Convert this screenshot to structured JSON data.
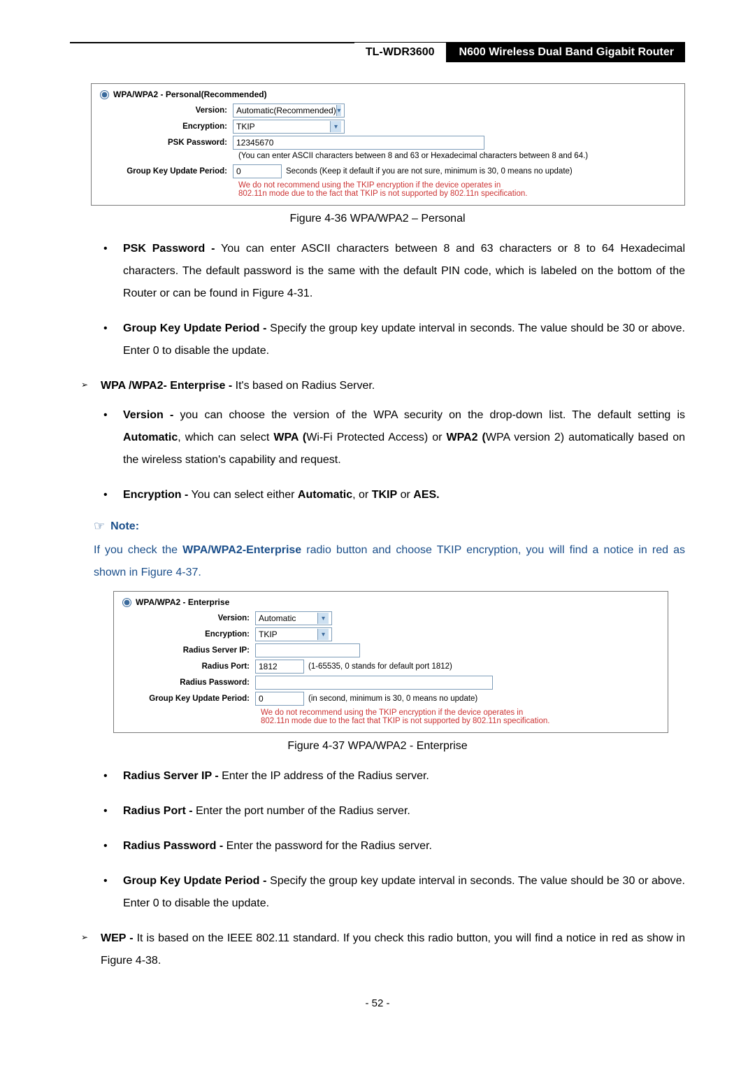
{
  "header": {
    "model": "TL-WDR3600",
    "title": "N600 Wireless Dual Band Gigabit Router"
  },
  "fig36": {
    "radio_label": "WPA/WPA2 - Personal(Recommended)",
    "labels": {
      "version": "Version:",
      "encryption": "Encryption:",
      "psk": "PSK Password:",
      "gkup": "Group Key Update Period:"
    },
    "values": {
      "version_sel": "Automatic(Recommended)",
      "encryption_sel": "TKIP",
      "psk_val": "12345670",
      "gkup_val": "0"
    },
    "hints": {
      "psk_hint": "(You can enter ASCII characters between 8 and 63 or Hexadecimal characters between 8 and 64.)",
      "gkup_hint": "Seconds (Keep it default if you are not sure, minimum is 30, 0 means no update)",
      "warn_l1": "We do not recommend using the TKIP encryption if the device operates in",
      "warn_l2": "802.11n mode due to the fact that TKIP is not supported by 802.11n specification."
    },
    "caption": "Figure 4-36 WPA/WPA2 – Personal"
  },
  "bullets_a": {
    "psk": {
      "head": "PSK Password -",
      "body": " You can enter ASCII characters between 8 and 63 characters or 8 to 64 Hexadecimal characters. The default password is the same with the default PIN code, which is labeled on the bottom of the Router or can be found in Figure 4-31."
    },
    "gkup": {
      "head": "Group Key Update Period -",
      "body": " Specify the group key update interval in seconds. The value should be 30 or above. Enter 0 to disable the update."
    }
  },
  "wpa_ent_head": {
    "title": "WPA /WPA2- Enterprise -",
    "body": " It's based on Radius Server."
  },
  "bullets_b": {
    "ver": {
      "head": "Version  -",
      "b": " you can choose the version of the WPA security on the drop-down list. The default setting is ",
      "auto": "Automatic",
      "c": ", which can select  ",
      "wpa": "WPA (",
      "d": "Wi-Fi Protected Access) or ",
      "wpa2": "WPA2 (",
      "e": "WPA version 2) automatically based on the wireless station's capability and request."
    },
    "enc": {
      "head": "Encryption -",
      "b": "  You can select either ",
      "auto": "Automatic",
      "c": ", or ",
      "tkip": "TKIP",
      "d": " or ",
      "aes": "AES."
    }
  },
  "note": {
    "label": "Note:",
    "text_a": "If you check the ",
    "text_b": "WPA/WPA2-Enterprise",
    "text_c": " radio button and choose TKIP encryption, you will find a notice in red as shown in Figure 4-37."
  },
  "fig37": {
    "radio_label": "WPA/WPA2 - Enterprise",
    "labels": {
      "version": "Version:",
      "encryption": "Encryption:",
      "rip": "Radius Server IP:",
      "rport": "Radius Port:",
      "rpwd": "Radius Password:",
      "gkup": "Group Key Update Period:"
    },
    "values": {
      "version_sel": "Automatic",
      "encryption_sel": "TKIP",
      "rport_val": "1812",
      "gkup_val": "0"
    },
    "hints": {
      "rport_hint": "(1-65535, 0 stands for default port 1812)",
      "gkup_hint": "(in second, minimum is 30, 0 means no update)",
      "warn_l1": "We do not recommend using the TKIP encryption if the device operates in",
      "warn_l2": "802.11n mode due to the fact that TKIP is not supported by 802.11n specification."
    },
    "caption": "Figure 4-37 WPA/WPA2 - Enterprise"
  },
  "bullets_c": {
    "rip": {
      "head": "Radius Server IP -",
      "body": " Enter the IP address of the Radius server."
    },
    "rport": {
      "head": "Radius Port -",
      "body": " Enter the port number of the Radius server."
    },
    "rpwd": {
      "head": "Radius Password -",
      "body": " Enter the password for the Radius server."
    },
    "gkup": {
      "head": "Group Key Update Period -",
      "body": " Specify the group key update interval in seconds. The value should be 30 or above. Enter 0 to disable the update."
    }
  },
  "wep": {
    "head": "WEP -",
    "body": " It is based on the IEEE 802.11 standard. If you check this radio button, you will find a notice in red as show in Figure 4-38."
  },
  "page_num": "- 52 -"
}
